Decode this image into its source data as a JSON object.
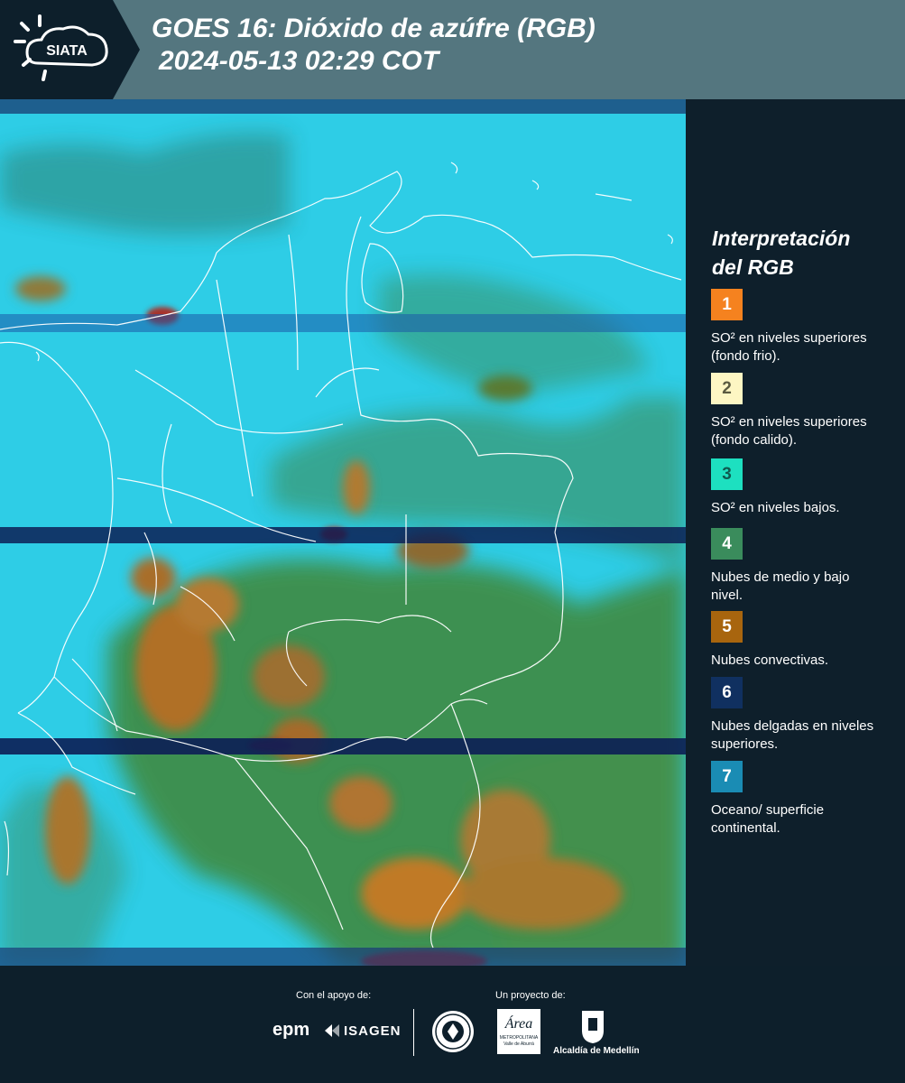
{
  "header": {
    "title_line1": "GOES 16: Dióxido de azúfre (RGB)",
    "title_line2": "2024-05-13 02:29 COT",
    "logo_text": "SIATA"
  },
  "legend": {
    "title_line1": "Interpretación",
    "title_line2": "del RGB",
    "items": [
      {
        "number": "1",
        "color": "#f5821f",
        "number_color": "#ffffff",
        "label": "SO² en niveles superiores (fondo frio)."
      },
      {
        "number": "2",
        "color": "#fdf6c3",
        "number_color": "#5a5a40",
        "label": "SO² en niveles superiores (fondo calido)."
      },
      {
        "number": "3",
        "color": "#1de0c0",
        "number_color": "#0f5a50",
        "label": "SO² en niveles bajos."
      },
      {
        "number": "4",
        "color": "#3a8c5c",
        "number_color": "#ffffff",
        "label": "Nubes de medio y bajo nivel."
      },
      {
        "number": "5",
        "color": "#a8650e",
        "number_color": "#ffffff",
        "label": "Nubes convectivas."
      },
      {
        "number": "6",
        "color": "#103060",
        "number_color": "#ffffff",
        "label": "Nubes delgadas en niveles superiores."
      },
      {
        "number": "7",
        "color": "#1a8cb4",
        "number_color": "#ffffff",
        "label": "Oceano/ superficie continental."
      }
    ]
  },
  "footer": {
    "support_label": "Con el apoyo de:",
    "project_label": "Un proyecto de:",
    "logo_epm": "epm",
    "logo_isagen": "ISAGEN",
    "logo_area": "Área",
    "logo_area_sub1": "METROPOLITANA",
    "logo_area_sub2": "Valle de Aburrá",
    "logo_alcaldia": "Alcaldía de Medellín"
  }
}
